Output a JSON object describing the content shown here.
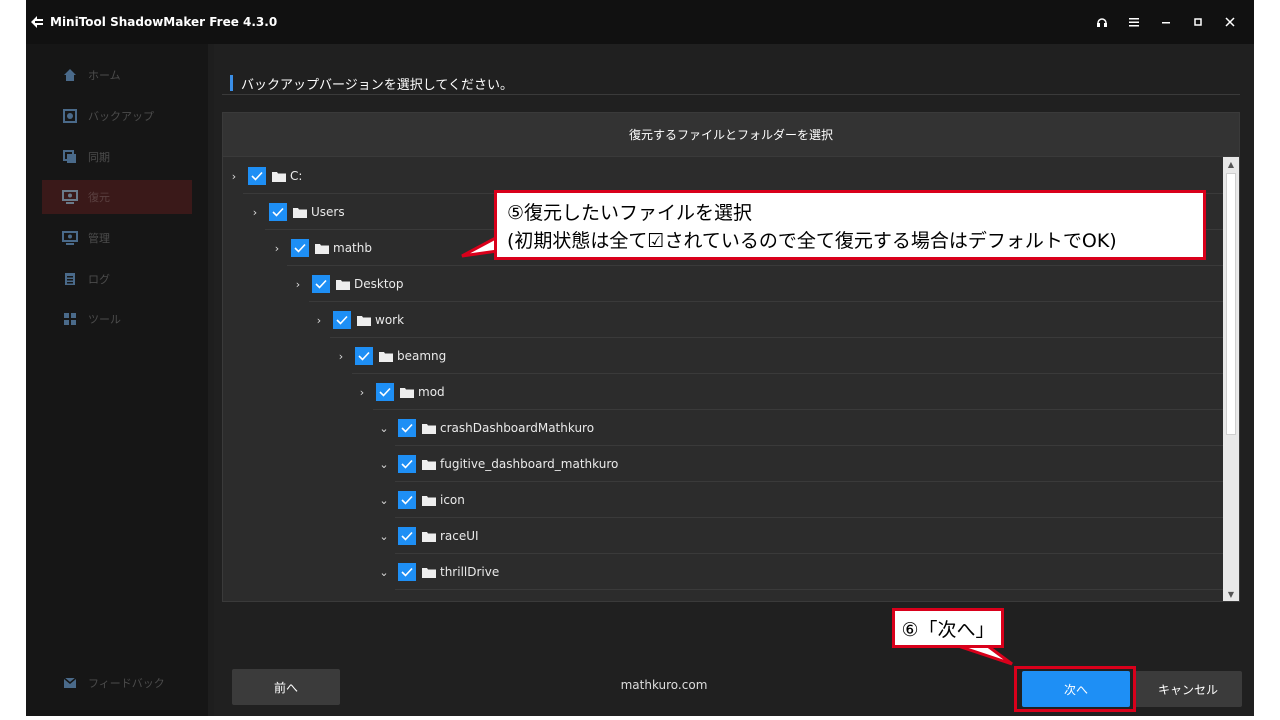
{
  "window": {
    "title": "MiniTool ShadowMaker Free 4.3.0",
    "controls": [
      "headset-icon",
      "menu-icon",
      "minimize-icon",
      "maximize-icon",
      "close-icon"
    ]
  },
  "sidebar": {
    "items": [
      {
        "label": "ホーム",
        "icon": "home-icon",
        "active": false
      },
      {
        "label": "バックアップ",
        "icon": "backup-icon",
        "active": false
      },
      {
        "label": "同期",
        "icon": "sync-icon",
        "active": false
      },
      {
        "label": "復元",
        "icon": "restore-icon",
        "active": true
      },
      {
        "label": "管理",
        "icon": "manage-icon",
        "active": false
      },
      {
        "label": "ログ",
        "icon": "log-icon",
        "active": false
      },
      {
        "label": "ツール",
        "icon": "tools-icon",
        "active": false
      }
    ],
    "feedback_label": "フィードバック"
  },
  "main": {
    "section_title": "バックアップバージョンを選択してください。",
    "panel_title": "復元するファイルとフォルダーを選択",
    "tree": [
      {
        "label": "C:",
        "level": 0,
        "expanded": false,
        "checked": true
      },
      {
        "label": "Users",
        "level": 1,
        "expanded": false,
        "checked": true
      },
      {
        "label": "mathb",
        "level": 2,
        "expanded": false,
        "checked": true
      },
      {
        "label": "Desktop",
        "level": 3,
        "expanded": false,
        "checked": true
      },
      {
        "label": "work",
        "level": 4,
        "expanded": false,
        "checked": true
      },
      {
        "label": "beamng",
        "level": 5,
        "expanded": false,
        "checked": true
      },
      {
        "label": "mod",
        "level": 6,
        "expanded": false,
        "checked": true
      },
      {
        "label": "crashDashboardMathkuro",
        "level": 7,
        "expanded": true,
        "checked": true
      },
      {
        "label": "fugitive_dashboard_mathkuro",
        "level": 7,
        "expanded": true,
        "checked": true
      },
      {
        "label": "icon",
        "level": 7,
        "expanded": true,
        "checked": true
      },
      {
        "label": "raceUI",
        "level": 7,
        "expanded": true,
        "checked": true
      },
      {
        "label": "thrillDrive",
        "level": 7,
        "expanded": true,
        "checked": true
      },
      {
        "label": "",
        "level": 7,
        "expanded": false,
        "checked": true
      }
    ]
  },
  "footer": {
    "prev_label": "前へ",
    "watermark": "mathkuro.com",
    "next_label": "次へ",
    "cancel_label": "キャンセル"
  },
  "annotations": {
    "callout1_line1": "⑤復元したいファイルを選択",
    "callout1_line2": "(初期状態は全て☑されているので全て復元する場合はデフォルトでOK)",
    "callout2": "⑥「次へ」",
    "color": "#d9001b"
  },
  "colors": {
    "accent": "#1e8ff5",
    "background": "#1e1e1e",
    "active_nav": "#3a1919"
  }
}
